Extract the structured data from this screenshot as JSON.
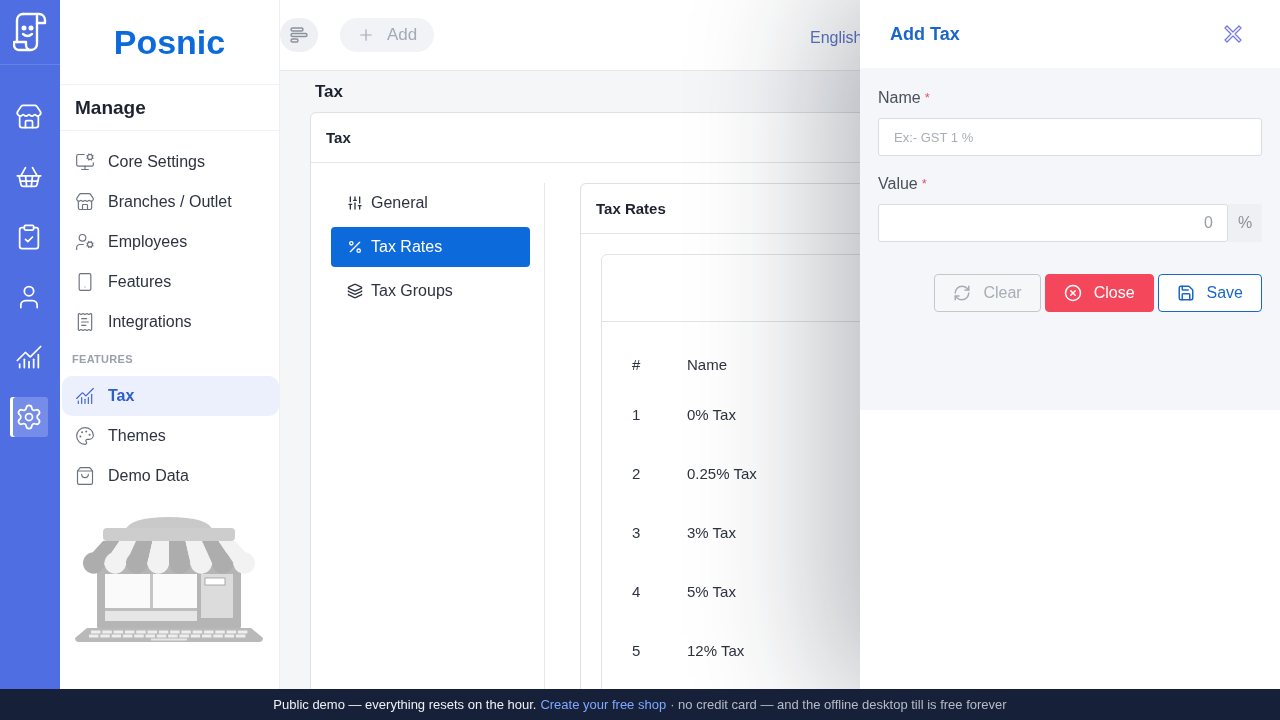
{
  "rail": {
    "items": [
      {
        "selected": false
      },
      {
        "selected": false
      },
      {
        "selected": false
      },
      {
        "selected": false
      },
      {
        "selected": false
      },
      {
        "selected": true
      }
    ]
  },
  "sidebar": {
    "brand": "Posnic",
    "title": "Manage",
    "sections": [
      {
        "items": [
          {
            "label": "Core Settings",
            "selected": false
          },
          {
            "label": "Branches / Outlet",
            "selected": false
          },
          {
            "label": "Employees",
            "selected": false
          },
          {
            "label": "Features",
            "selected": false
          },
          {
            "label": "Integrations",
            "selected": false
          }
        ]
      },
      {
        "heading": "FEATURES",
        "items": [
          {
            "label": "Tax",
            "selected": true
          },
          {
            "label": "Themes",
            "selected": false
          },
          {
            "label": "Demo Data",
            "selected": false
          }
        ]
      }
    ]
  },
  "header": {
    "add_button": "Add",
    "language": "English"
  },
  "page": {
    "title": "Tax",
    "card_title": "Tax",
    "tabs": [
      {
        "label": "General",
        "selected": false
      },
      {
        "label": "Tax Rates",
        "selected": true
      },
      {
        "label": "Tax Groups",
        "selected": false
      }
    ],
    "panel": {
      "title": "Tax Rates",
      "table": {
        "columns": [
          "#",
          "Name"
        ],
        "rows": [
          [
            "1",
            "0% Tax"
          ],
          [
            "2",
            "0.25% Tax"
          ],
          [
            "3",
            "3% Tax"
          ],
          [
            "4",
            "5% Tax"
          ],
          [
            "5",
            "12% Tax"
          ]
        ]
      }
    }
  },
  "drawer": {
    "title": "Add Tax",
    "fields": [
      {
        "kind": "text",
        "label": "Name",
        "required_mark": "*",
        "placeholder": "Ex:- GST 1 %"
      },
      {
        "kind": "number",
        "label": "Value",
        "required_mark": "*",
        "placeholder": "0",
        "suffix": "%"
      }
    ],
    "buttons": [
      {
        "kind": "clear",
        "label": "Clear",
        "disabled": true
      },
      {
        "kind": "close",
        "label": "Close",
        "disabled": false
      },
      {
        "kind": "save",
        "label": "Save",
        "disabled": false
      }
    ]
  },
  "banner": {
    "message": "Public demo — everything resets on the hour.",
    "link": "Create your free shop",
    "note": "· no credit card — and the offline desktop till is free forever"
  }
}
